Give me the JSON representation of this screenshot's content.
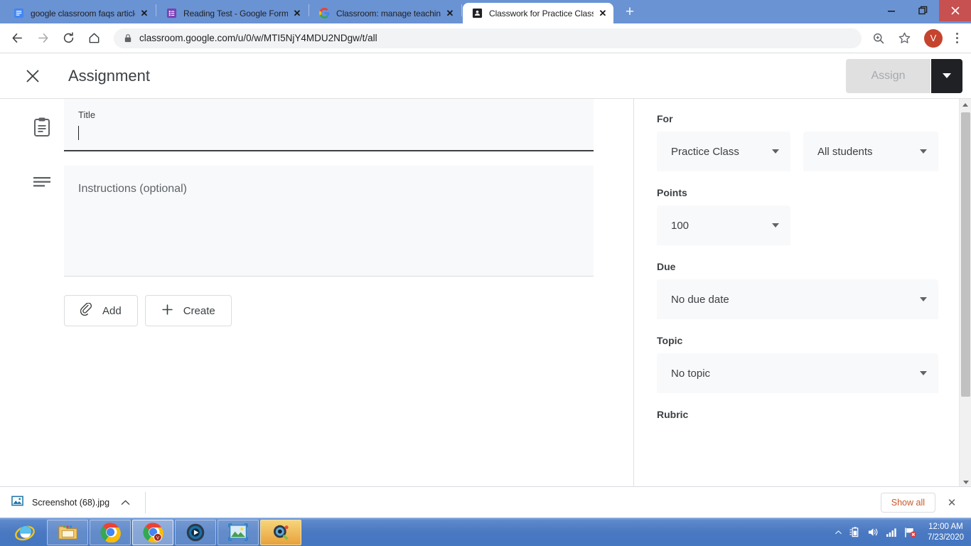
{
  "window": {
    "minimize_label": "—",
    "restore_label": "❐",
    "close_label": "✕"
  },
  "tabs": [
    {
      "title": "google classroom faqs article.doc",
      "icon": "google-docs-icon",
      "active": false,
      "close_label": "✕"
    },
    {
      "title": "Reading Test - Google Forms",
      "icon": "google-forms-icon",
      "active": false,
      "close_label": "✕"
    },
    {
      "title": "Classroom: manage teaching and",
      "icon": "google-g-icon",
      "active": false,
      "close_label": "✕"
    },
    {
      "title": "Classwork for Practice Class",
      "icon": "google-classroom-icon",
      "active": true,
      "close_label": "✕"
    }
  ],
  "new_tab_label": "+",
  "toolbar": {
    "back_icon": "back-arrow-icon",
    "forward_icon": "forward-arrow-icon",
    "reload_icon": "reload-icon",
    "home_icon": "home-icon",
    "lock_icon": "lock-icon",
    "url_domain": "classroom.google.com",
    "url_path": "/u/0/w/MTI5NjY4MDU2NDgw/t/all",
    "url_full": "classroom.google.com/u/0/w/MTI5NjY4MDU2NDgw/t/all",
    "zoom_icon": "zoom-search-icon",
    "bookmark_icon": "star-icon",
    "avatar_letter": "V",
    "menu_icon": "kebab-menu-icon"
  },
  "appbar": {
    "close_label": "✕",
    "title": "Assignment",
    "assign_label": "Assign",
    "assign_disabled": true
  },
  "form": {
    "title_label": "Title",
    "title_value": "",
    "title_icon": "assignment-clipboard-icon",
    "instructions_placeholder": "Instructions (optional)",
    "instructions_value": "",
    "instructions_icon": "text-lines-icon",
    "add_label": "Add",
    "add_icon": "paperclip-icon",
    "create_label": "Create",
    "create_icon": "plus-icon",
    "help_icon": "help-circle-icon"
  },
  "sidebar": {
    "for_label": "For",
    "class_value": "Practice Class",
    "students_value": "All students",
    "points_label": "Points",
    "points_value": "100",
    "due_label": "Due",
    "due_value": "No due date",
    "topic_label": "Topic",
    "topic_value": "No topic",
    "rubric_label": "Rubric"
  },
  "downloads": {
    "file_name": "Screenshot (68).jpg",
    "file_icon": "image-file-icon",
    "expand_icon": "chevron-up-icon",
    "show_all_label": "Show all",
    "close_label": "✕"
  },
  "taskbar": {
    "apps": [
      {
        "name": "internet-explorer",
        "label": "Internet Explorer"
      },
      {
        "name": "file-explorer",
        "label": "File Explorer"
      },
      {
        "name": "google-chrome",
        "label": "Google Chrome"
      },
      {
        "name": "google-chrome-profile",
        "label": "Google Chrome"
      },
      {
        "name": "media-player",
        "label": "Media Player"
      },
      {
        "name": "photo-viewer",
        "label": "Photo Viewer"
      },
      {
        "name": "photo-editor",
        "label": "Photo Editor"
      }
    ],
    "tray": {
      "show_hidden_icon": "chevron-up-icon",
      "battery_icon": "battery-icon",
      "volume_icon": "volume-icon",
      "network_icon": "signal-bars-icon",
      "flag_icon": "action-center-flag-icon",
      "time": "12:00 AM",
      "date": "7/23/2020"
    }
  },
  "colors": {
    "chrome_tabstrip": "#6a93d4",
    "accent_dark": "#202124",
    "field_bg": "#f8f9fa",
    "avatar": "#c5442e",
    "close_btn": "#c75050",
    "taskbar": "#4a79c2"
  }
}
